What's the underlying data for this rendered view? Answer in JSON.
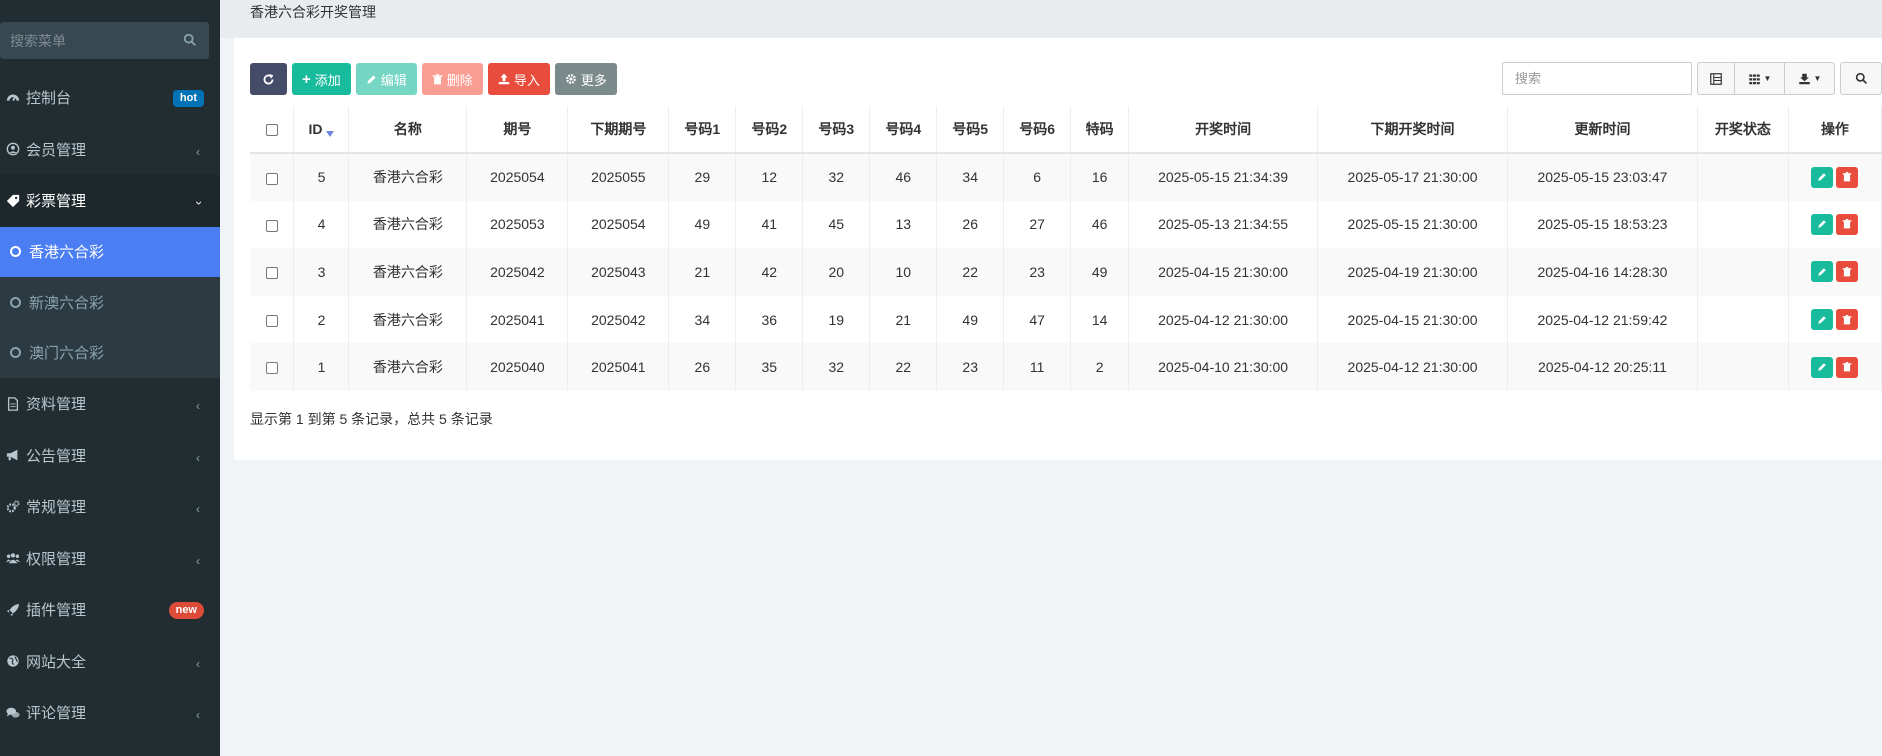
{
  "sidebar": {
    "search_placeholder": "搜索菜单",
    "menu": [
      {
        "label": "控制台",
        "icon": "dashboard-icon",
        "badge": "hot"
      },
      {
        "label": "会员管理",
        "icon": "user-icon"
      },
      {
        "label": "彩票管理",
        "icon": "tag-icon",
        "open": true,
        "children": [
          {
            "label": "香港六合彩",
            "active": true
          },
          {
            "label": "新澳六合彩"
          },
          {
            "label": "澳门六合彩"
          }
        ]
      },
      {
        "label": "资料管理",
        "icon": "file-icon"
      },
      {
        "label": "公告管理",
        "icon": "bullhorn-icon"
      },
      {
        "label": "常规管理",
        "icon": "gears-icon"
      },
      {
        "label": "权限管理",
        "icon": "users-icon"
      },
      {
        "label": "插件管理",
        "icon": "rocket-icon",
        "badge": "new"
      },
      {
        "label": "网站大全",
        "icon": "globe-icon"
      },
      {
        "label": "评论管理",
        "icon": "comments-icon"
      }
    ]
  },
  "topbar": {
    "title": "香港六合彩开奖管理"
  },
  "toolbar": {
    "add": "添加",
    "edit": "编辑",
    "delete": "删除",
    "import": "导入",
    "more": "更多",
    "search_placeholder": "搜索"
  },
  "table": {
    "headers": [
      "ID",
      "名称",
      "期号",
      "下期期号",
      "号码1",
      "号码2",
      "号码3",
      "号码4",
      "号码5",
      "号码6",
      "特码",
      "开奖时间",
      "下期开奖时间",
      "更新时间",
      "开奖状态",
      "操作"
    ],
    "rows": [
      [
        "5",
        "香港六合彩",
        "2025054",
        "2025055",
        "29",
        "12",
        "32",
        "46",
        "34",
        "6",
        "16",
        "2025-05-15 21:34:39",
        "2025-05-17 21:30:00",
        "2025-05-15 23:03:47",
        ""
      ],
      [
        "4",
        "香港六合彩",
        "2025053",
        "2025054",
        "49",
        "41",
        "45",
        "13",
        "26",
        "27",
        "46",
        "2025-05-13 21:34:55",
        "2025-05-15 21:30:00",
        "2025-05-15 18:53:23",
        ""
      ],
      [
        "3",
        "香港六合彩",
        "2025042",
        "2025043",
        "21",
        "42",
        "20",
        "10",
        "22",
        "23",
        "49",
        "2025-04-15 21:30:00",
        "2025-04-19 21:30:00",
        "2025-04-16 14:28:30",
        ""
      ],
      [
        "2",
        "香港六合彩",
        "2025041",
        "2025042",
        "34",
        "36",
        "19",
        "21",
        "49",
        "47",
        "14",
        "2025-04-12 21:30:00",
        "2025-04-15 21:30:00",
        "2025-04-12 21:59:42",
        ""
      ],
      [
        "1",
        "香港六合彩",
        "2025040",
        "2025041",
        "26",
        "35",
        "32",
        "22",
        "23",
        "11",
        "2",
        "2025-04-10 21:30:00",
        "2025-04-12 21:30:00",
        "2025-04-12 20:25:11",
        ""
      ]
    ]
  },
  "footer": {
    "summary": "显示第 1 到第 5 条记录，总共 5 条记录"
  }
}
